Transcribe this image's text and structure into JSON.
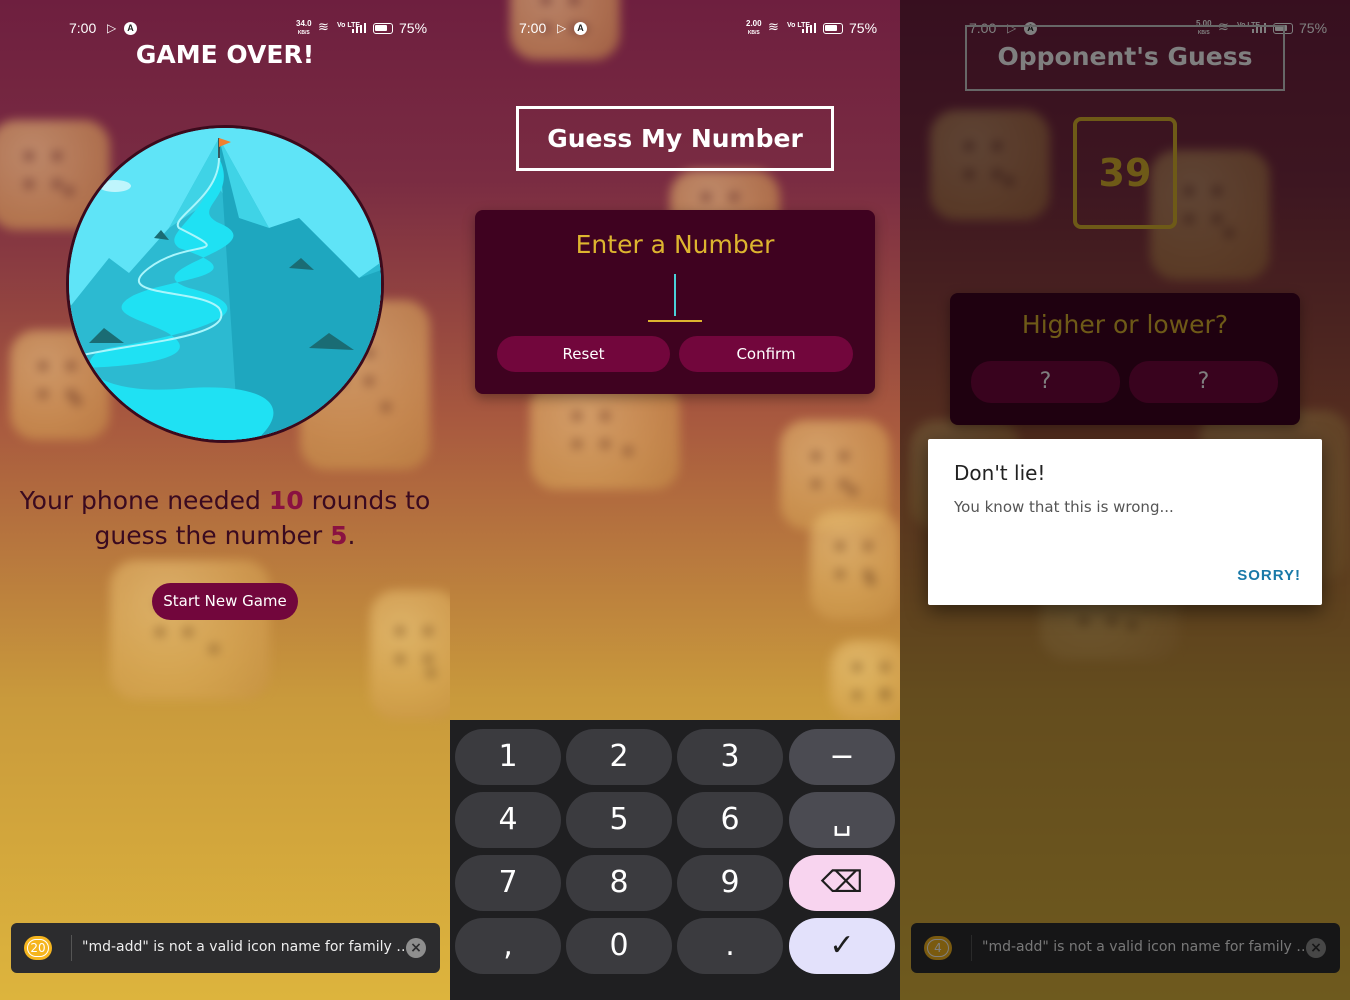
{
  "status_bar": [
    {
      "time": "7:00",
      "net_speed": "34.0",
      "net_unit": "KB/S",
      "volte": "Vo LTE",
      "battery": "75%"
    },
    {
      "time": "7:00",
      "net_speed": "2.00",
      "net_unit": "KB/S",
      "volte": "Vo LTE",
      "battery": "75%"
    },
    {
      "time": "7:00",
      "net_speed": "5.00",
      "net_unit": "KB/S",
      "volte": "Vo LTE",
      "battery": "75%"
    }
  ],
  "game_over": {
    "title": "GAME OVER!",
    "result_prefix": "Your phone needed ",
    "rounds": "10",
    "result_middle": " rounds to guess the number ",
    "number": "5",
    "result_suffix": ".",
    "start_button": "Start New Game"
  },
  "toast": {
    "count": "20",
    "count_dimmed": "4",
    "message": "\"md-add\" is not a valid icon name for family \"ionicons\""
  },
  "start_screen": {
    "title": "Guess My Number",
    "card_title": "Enter a Number",
    "input_value": "",
    "reset_button": "Reset",
    "confirm_button": "Confirm"
  },
  "keyboard": {
    "keys": [
      "1",
      "2",
      "3",
      "−",
      "4",
      "5",
      "6",
      "␣",
      "7",
      "8",
      "9",
      "⌫",
      ",",
      "0",
      ".",
      "✓"
    ]
  },
  "game_screen": {
    "title": "Opponent's Guess",
    "guess": "39",
    "card_title": "Higher or lower?",
    "lower_button": "?",
    "higher_button": "?"
  },
  "dialog": {
    "title": "Don't lie!",
    "message": "You know that this is wrong...",
    "button": "SORRY!"
  },
  "colors": {
    "primary": "#72063c",
    "accent": "#ddb52f",
    "card": "#3f0220",
    "dialog_button": "#1979a8"
  }
}
